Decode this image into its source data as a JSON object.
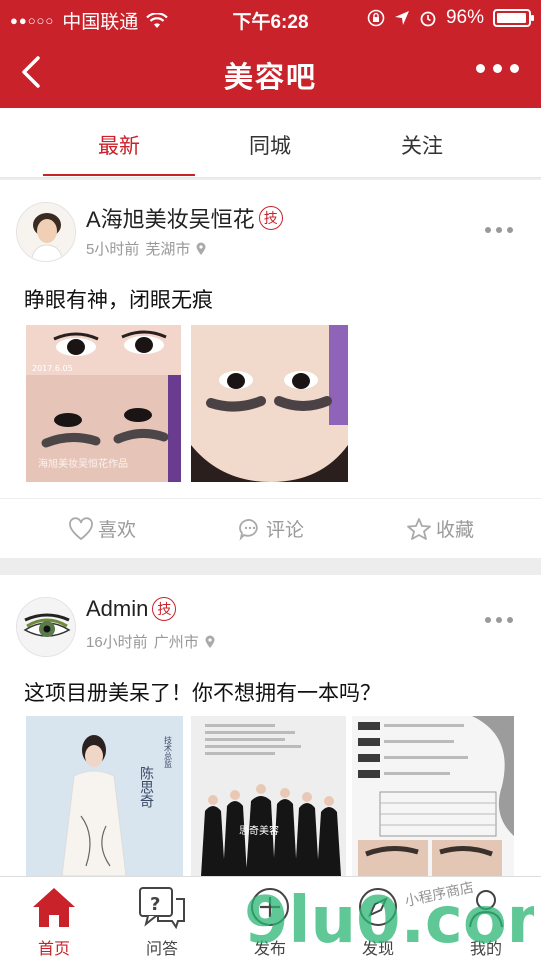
{
  "status_bar": {
    "carrier": "中国联通",
    "time": "下午6:28",
    "battery": "96%",
    "battery_level": 0.96
  },
  "nav": {
    "title": "美容吧"
  },
  "tabs": [
    {
      "label": "最新",
      "active": true
    },
    {
      "label": "同城",
      "active": false
    },
    {
      "label": "关注",
      "active": false
    }
  ],
  "posts": [
    {
      "author": "A海旭美妆吴恒花",
      "badge": "技",
      "time": "5小时前",
      "city": "芜湖市",
      "text": "睁眼有神，闭眼无痕",
      "image_caption_date": "2017.6.05",
      "image_caption_watermark": "海旭美妆吴恒花作品",
      "actions": {
        "like": "喜欢",
        "comment": "评论",
        "favorite": "收藏"
      }
    },
    {
      "author": "Admin",
      "badge": "技",
      "time": "16小时前",
      "city": "广州市",
      "text": "这项目册美呆了！你不想拥有一本吗？",
      "image1_text": "陈思奇",
      "image1_subtext": "技术总监",
      "image2_text": "思奇美容"
    }
  ],
  "bottom_tabs": [
    {
      "label": "首页",
      "icon": "home-icon",
      "active": true
    },
    {
      "label": "问答",
      "icon": "qa-icon",
      "active": false
    },
    {
      "label": "发布",
      "icon": "post-icon",
      "active": false
    },
    {
      "label": "发现",
      "icon": "discover-icon",
      "active": false
    },
    {
      "label": "我的",
      "icon": "profile-icon",
      "active": false
    }
  ],
  "watermark": {
    "main": "9lu0.com",
    "small": "小程序商店"
  },
  "colors": {
    "brand_red": "#c9222b"
  }
}
